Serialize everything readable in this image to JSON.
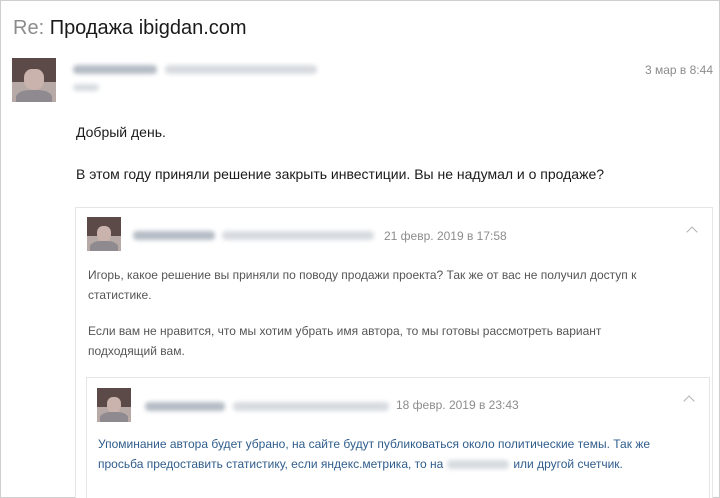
{
  "subject": {
    "prefix": "Re:",
    "title": "Продажа ibigdan.com"
  },
  "message": {
    "date": "3 мар в 8:44",
    "greeting": "Добрый день.",
    "text": "В этом году приняли решение закрыть инвестиции. Вы не надумал и о продаже?"
  },
  "quote1": {
    "date": "21 февр. 2019 в 17:58",
    "paragraph1_line1": "Игорь, какое решение вы приняли по поводу продажи проекта? Так же от вас не получил доступ к",
    "paragraph1_line2": "статистике.",
    "paragraph2_line1": "Если вам не нравится, что мы хотим убрать имя автора, то мы готовы рассмотреть вариант",
    "paragraph2_line2": "подходящий вам."
  },
  "quote2": {
    "date": "18 февр. 2019 в 23:43",
    "line1": "Упоминание автора будет убрано, на сайте будут публиковаться около политические темы. Так же",
    "line2_start": "просьба предоставить статистику, если яндекс.метрика, то на",
    "line2_end": "или другой счетчик."
  },
  "colors": {
    "muted": "#8c8c8c",
    "quote_link_text": "#2f5d8c",
    "border": "#e6e6e6"
  },
  "icons": [
    "avatar",
    "chevron-up-icon"
  ]
}
